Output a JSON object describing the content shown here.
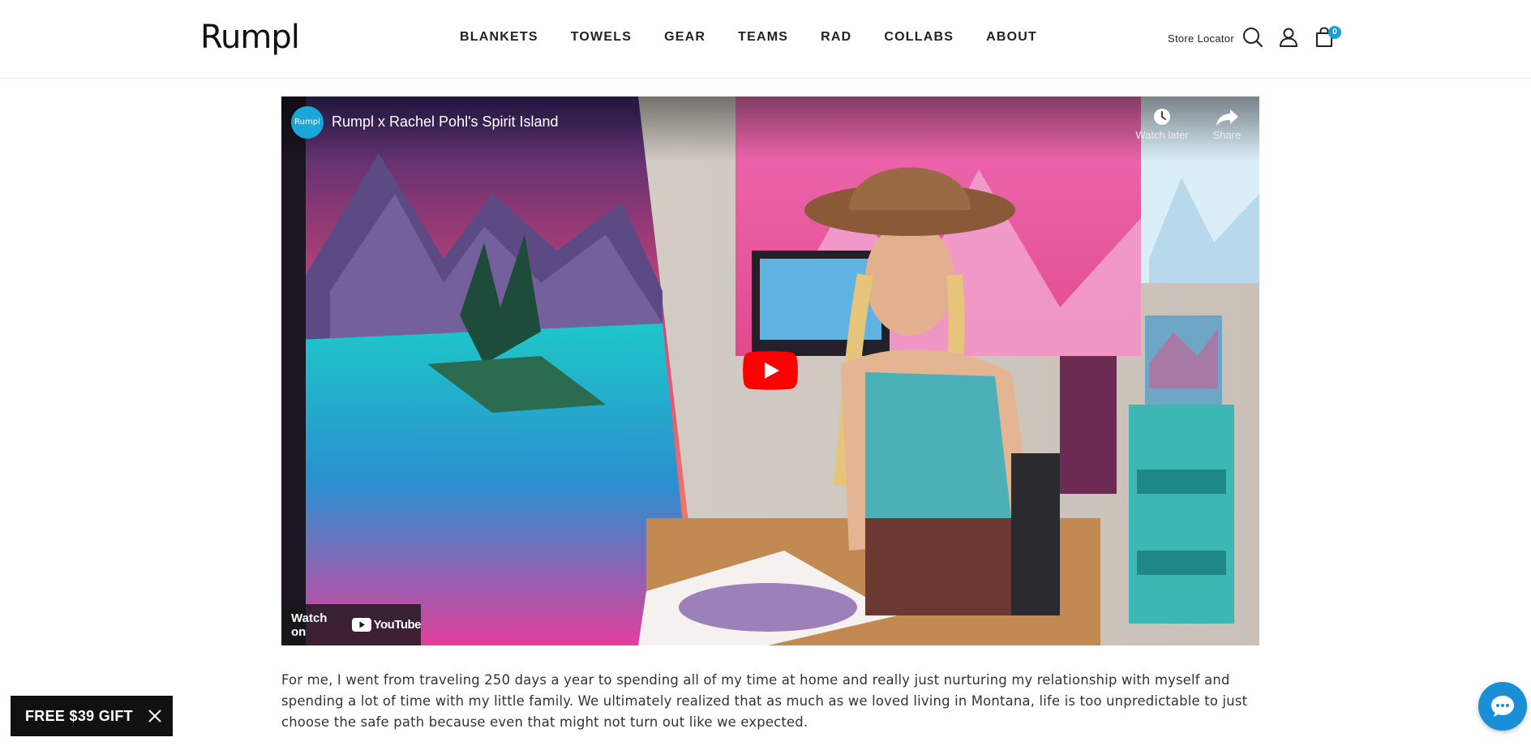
{
  "brand": {
    "logo_text": "Rumpl"
  },
  "nav": {
    "items": [
      {
        "label": "BLANKETS"
      },
      {
        "label": "TOWELS"
      },
      {
        "label": "GEAR"
      },
      {
        "label": "TEAMS"
      },
      {
        "label": "RAD"
      },
      {
        "label": "COLLABS"
      },
      {
        "label": "ABOUT"
      }
    ]
  },
  "header": {
    "store_locator": "Store Locator",
    "cart_count": "0",
    "icons": [
      "search-icon",
      "account-icon",
      "cart-icon"
    ]
  },
  "video": {
    "channel_avatar_text": "Rumpl",
    "title": "Rumpl x Rachel Pohl's Spirit Island",
    "watch_later": "Watch later",
    "share": "Share",
    "watch_on": "Watch on",
    "youtube": "YouTube"
  },
  "article": {
    "paragraph": "For me, I went from traveling 250 days a year to spending all of my time at home and really just nurturing my relationship with myself and spending a lot of time with my little family. We ultimately realized that as much as we loved living in Montana, life is too unpredictable to just choose the safe path because even that might not turn out like we expected."
  },
  "promo": {
    "gift_label": "FREE $39 GIFT"
  },
  "colors": {
    "accent_blue": "#1a9ed8",
    "youtube_red": "#ff0000",
    "gift_bg": "#111111",
    "chat_blue": "#1a8fd6"
  }
}
